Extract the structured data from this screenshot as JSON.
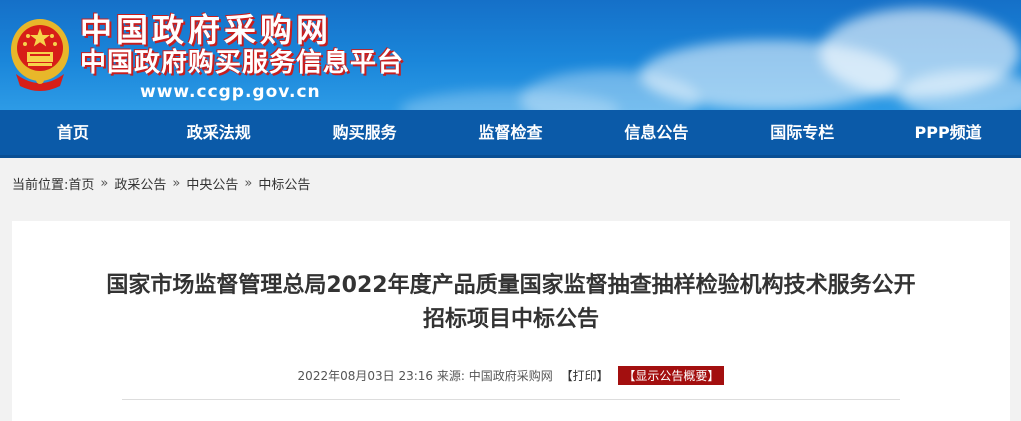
{
  "header": {
    "title": "中国政府采购网",
    "subtitle": "中国政府购买服务信息平台",
    "url": "www.ccgp.gov.cn",
    "emblem_icon": "national-emblem-icon"
  },
  "nav": {
    "items": [
      {
        "label": "首页"
      },
      {
        "label": "政采法规"
      },
      {
        "label": "购买服务"
      },
      {
        "label": "监督检查"
      },
      {
        "label": "信息公告"
      },
      {
        "label": "国际专栏"
      },
      {
        "label": "PPP频道"
      }
    ]
  },
  "breadcrumb": {
    "prefix": "当前位置:",
    "items": [
      "首页",
      "政采公告",
      "中央公告",
      "中标公告"
    ],
    "separator": "»"
  },
  "article": {
    "title_line1": "国家市场监督管理总局2022年度产品质量国家监督抽查抽样检验机构技术服务公开",
    "title_line2": "招标项目中标公告",
    "date": "2022年08月03日 23:16",
    "source_label": "来源:",
    "source": "中国政府采购网",
    "print_label": "【打印】",
    "summary_label": "【显示公告概要】"
  },
  "colors": {
    "nav_bg": "#0b5aa8",
    "summary_bg": "#a30f0f",
    "banner_top": "#1570c8"
  }
}
